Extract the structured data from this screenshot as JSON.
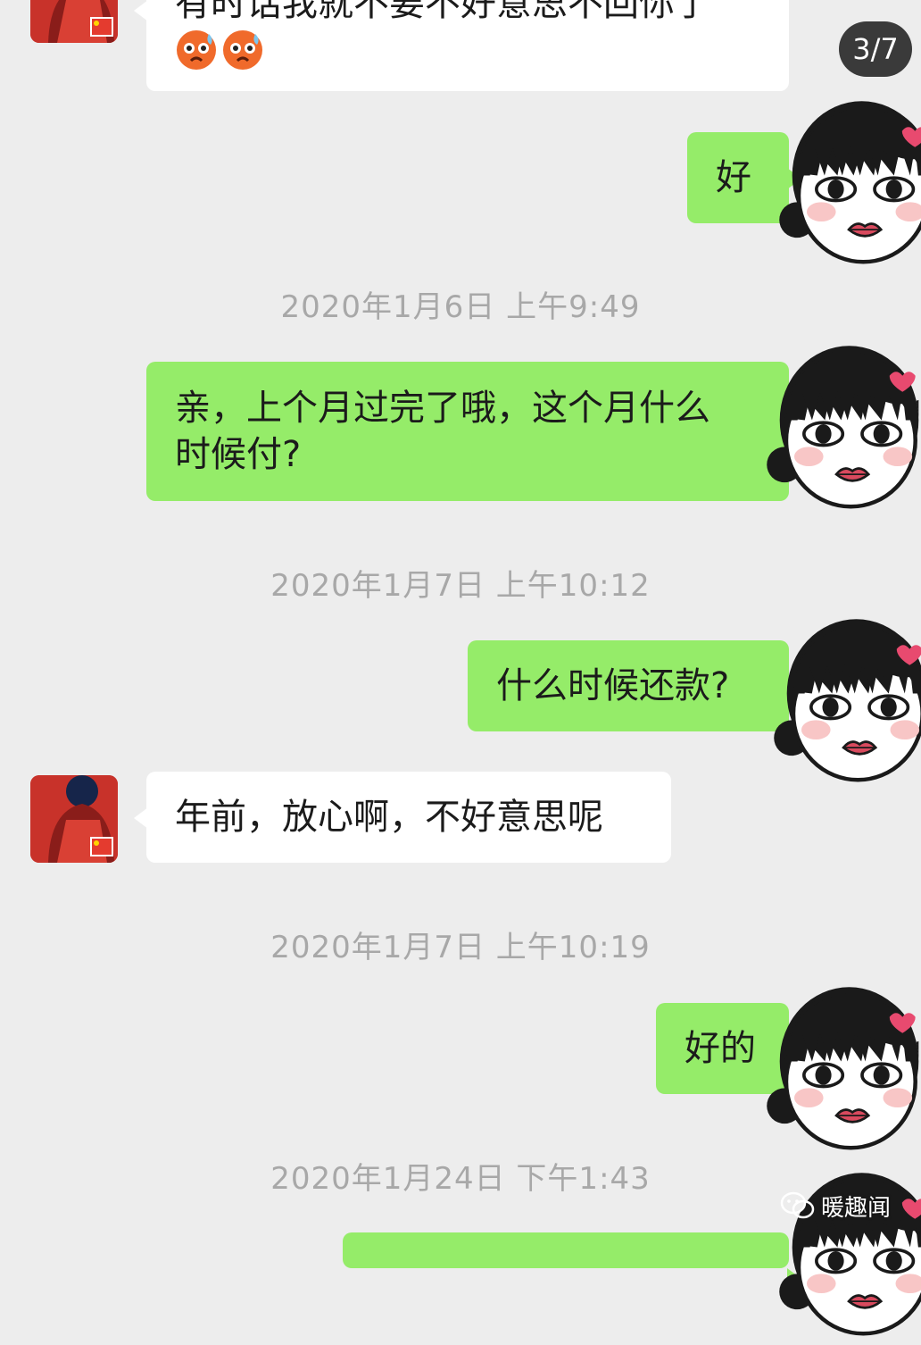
{
  "page_indicator": "3/7",
  "watermark": {
    "text": "暖趣闻",
    "icon": "wechat-icon"
  },
  "colors": {
    "background": "#ededed",
    "my_bubble": "#95ec69",
    "their_bubble": "#ffffff",
    "timestamp": "#a8a8a8"
  },
  "messages": {
    "m0": {
      "text": "有时话我就不要不好意思不回你了",
      "emoji": [
        "cold-sweat-emoji",
        "cold-sweat-emoji"
      ]
    },
    "m1": {
      "text": "好"
    },
    "t1": "2020年1月6日 上午9:49",
    "m2": {
      "line1": "亲，上个月过完了哦，这个月什么",
      "line2": "时候付?"
    },
    "t2": "2020年1月7日 上午10:12",
    "m3": {
      "text": "什么时候还款?"
    },
    "m4": {
      "text": "年前，放心啊，不好意思呢"
    },
    "t3": "2020年1月7日 上午10:19",
    "m5": {
      "text": "好的"
    },
    "t4": "2020年1月24日 下午1:43"
  }
}
